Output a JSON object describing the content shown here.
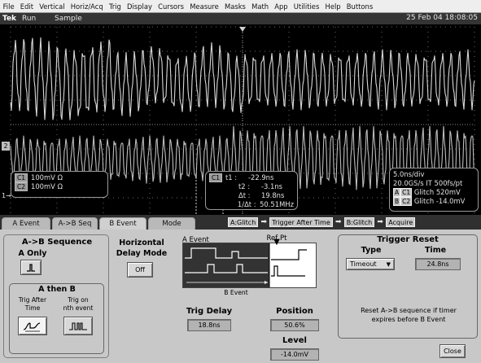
{
  "menu": [
    "File",
    "Edit",
    "Vertical",
    "Horiz/Acq",
    "Trig",
    "Display",
    "Cursors",
    "Measure",
    "Masks",
    "Math",
    "App",
    "Utilities",
    "Help",
    "Buttons"
  ],
  "status": {
    "brand": "Tek",
    "run": "Run",
    "sample": "Sample",
    "datetime": "25 Feb 04 18:08:05"
  },
  "scope": {
    "channel_markers": {
      "ch1": "1",
      "ch2": "2"
    },
    "channel_readout": {
      "c1_badge": "C1",
      "c1_scale": "100mV",
      "c1_unit": "Ω",
      "c2_badge": "C2",
      "c2_scale": "100mV",
      "c2_unit": "Ω"
    },
    "cursor_readout": {
      "badge": "C1",
      "t1_label": "t1 :",
      "t1": "-22.9ns",
      "t2_label": "t2 :",
      "t2": "-3.1ns",
      "dt_label": "Δt :",
      "dt": "19.8ns",
      "inv_label": "1/Δt :",
      "inv": "50.51MHz"
    },
    "horiz_readout": {
      "timebase": "5.0ns/div",
      "rate": "20.0GS/s IT 500fs/pt",
      "a_label": "A",
      "a_badge": "C1",
      "a_text": "Glitch  520mV",
      "b_label": "B",
      "b_badge": "C2",
      "b_text": "Glitch  -14.0mV"
    }
  },
  "tabs": [
    "A Event",
    "A->B Seq",
    "B Event",
    "Mode"
  ],
  "active_tab": "B Event",
  "sequence": {
    "items": [
      "A:Glitch",
      "Trigger After Time",
      "B:Glitch",
      "Acquire"
    ],
    "arrow": "➡"
  },
  "panel": {
    "ab_sequence": {
      "title": "A->B Sequence",
      "a_only": "A Only",
      "a_then_b": "A then B",
      "trig_after_time": "Trig After\nTime",
      "trig_nth": "Trig on\nnth event"
    },
    "horizontal": {
      "title": "Horizontal\nDelay Mode",
      "off": "Off"
    },
    "diagram": {
      "a_event": "A Event",
      "ref_pt": "Ref Pt",
      "b_event": "B Event"
    },
    "trig_delay": {
      "label": "Trig Delay",
      "value": "18.8ns"
    },
    "position": {
      "label": "Position",
      "value": "50.6%"
    },
    "level": {
      "label": "Level",
      "value": "-14.0mV"
    },
    "trigger_reset": {
      "title": "Trigger Reset",
      "type_label": "Type",
      "type_value": "Timeout",
      "time_label": "Time",
      "time_value": "24.8ns",
      "note": "Reset A->B sequence if timer\nexpires before B Event"
    },
    "close": "Close"
  }
}
